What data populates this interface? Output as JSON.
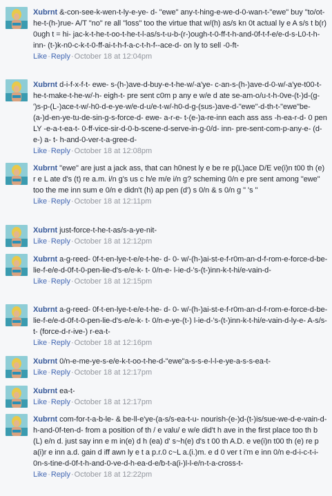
{
  "actions": {
    "like": "Like",
    "reply": "Reply",
    "separator": "·"
  },
  "comments": [
    {
      "author": "Xubrnt",
      "text": "&-con-see-k-wen-t-ly-e-ye- d- \"ewe\" any-t-hing-e-we-d-0-wan-t-\"ewe\" buy \"to/ot-he-t-(h-)rue- A/T \"no\" re all \"loss\" too the virtue that w/(h) as/s kn 0t actual ly e A s/s t b(r) 0ugh t = hi- jac-k-t-he-t-oo-t-he-t-l-as/s-t-u-b-(r-)ough-t-0-ff-t-h-and-0f-t-f-e/e-d-s-L0-t-h- inn- (t-)k-n0-c-k-t-0-ff-ai-t-h-f-a-c-t-h-f--ace-d- on ly to sell -0-ft-",
      "time": "October 18 at 12:04pm"
    },
    {
      "author": "Xubrnt",
      "text": "d-i-f-x-f-t- ewe- s-(h-)ave-d-buy-e-t-he-w/-a'ye- c-an-s-(h-)ave-d-0-w/-a'ye-t00-t-he-t-make-t-he-w/-h- eigh-t- pre sent c0m p any e w/e d ate se-am-o/u-t-h-0ve-(t-)d-(g-')s-p-(L-)ace-t-w/-h0-d-e-ye-w/e-d-u/e-t-w/-h0-d-g-(sus-)ave-d-\"ewe\"-d-th-t-\"ewe\"be-(a-)d-en-ye-tu-de-sin-g-s-force-d- ewe- a-r-e- t-(e-)a-re-inn each ass ass -h-ea-r-d- 0 pen LY -e-a-t-ea-t- 0-ff-vice-sir-d-0-b-scene-d-serve-in-g-0/d- inn- pre-sent-com-p-any-e- (d-e-) a- t- h-and-0-ver-t-a-gree-d-",
      "time": "October 18 at 12:08pm"
    },
    {
      "author": "Xubrnt",
      "text": "\"ewe\" are just a jack ass, that can h0nest ly e be re p(L)ace D/E ve(i)n t00 th (e) r e L ate d's (t) re a.m. i/n g's us c h/e m/e i/n g? scheming 0/n e pre sent among \"ewe\" too the me inn sum e 0/n e didn't (h) ap pen (d') s 0/n & s 0/n g \" 's \"",
      "time": "October 18 at 12:11pm"
    },
    {
      "author": "Xubrnt",
      "text": "just-force-t-he-t-as/s-a-ye-nit-",
      "time": "October 18 at 12:12pm"
    },
    {
      "author": "Xubrnt",
      "text": "a-g-reed- 0f-t-en-lye-t-e/e-t-he- d- 0- w/-(h-)ai-st-e-f-r0m-an-d-f-rom-e-force-d-be-lie-f-e/e-d-0f-t-0-pen-lie-d's-e/e-k- t- 0/n-e- l-ie-d-'s-(t-)inn-k-t-hi/e-vain-d-",
      "time": "October 18 at 12:15pm"
    },
    {
      "author": "Xubrnt",
      "text": "a-g-reed- 0f-t-en-lye-t-e/e-t-he- d- 0- w/-(h-)ai-st-e-f-r0m-an-d-f-rom-e-force-d-be-lie-f-e/e-d-0f-t-0-pen-lie-d's-e/e-k- t- 0/n-e-ye-(t-) l-ie-d-'s-(t-)inn-k-t-hi/e-vain-d-ly-e- A-s/s-t- (force-d-r-ive-) r-ea-t-",
      "time": "October 18 at 12:16pm"
    },
    {
      "author": "Xubrnt",
      "text": "0/n-e-me-ye-s-e/e-k-t-oo-t-he-d-\"ewe\"a-s-s-e-l-l-e-ye-a-s-s-ea-t-",
      "time": "October 18 at 12:17pm"
    },
    {
      "author": "Xubrnt",
      "text": "ea-t-",
      "time": "October 18 at 12:17pm"
    },
    {
      "author": "Xubrnt",
      "text": "com-for-t-a-b-le- & be-ll-e'ye-(a-s/s-ea-t-u- nourish-(e-)d-(t-)is/sue-we-d-e-vain-d-h-and-0f-ten-d- from a position of th / e valu/ e w/e did't h ave in the first place too th b (L) e/n d. just say inn e m in(e) d h (ea) d' s~h(e) d's t 00 th A.D. e ve(i)n t00 th (e) re p a(i)r e inn a.d. gain d iff awn ly e t a p.r.0 c~L a.(i.)m. e d 0 ver t i'm e inn 0/n e-d-i-c-t-i-0n-s-tine-d-0f-t-h-and-0-ve-d-h-ea-d-e/b-t-a(i-)l-l-e/n-t-a-cross-t-",
      "time": "October 18 at 12:22pm"
    }
  ]
}
